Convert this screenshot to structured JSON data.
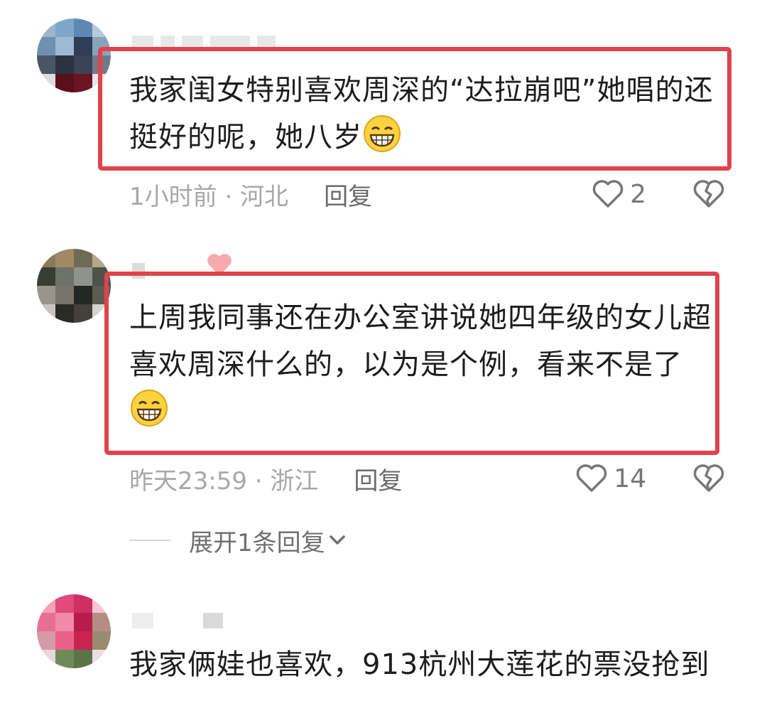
{
  "comments": [
    {
      "text": "我家闺女特别喜欢周深的“达拉崩吧”她唱的还挺好的呢，她八岁",
      "emoji": "grinning-face-icon",
      "time_location": "1小时前 · 河北",
      "reply_label": "回复",
      "likes": "2"
    },
    {
      "text": "上周我同事还在办公室讲说她四年级的女儿超喜欢周深什么的，以为是个例，看来不是了",
      "emoji": "grinning-face-icon",
      "time_location": "昨天23:59 · 浙江",
      "reply_label": "回复",
      "likes": "14",
      "expand_label": "展开1条回复"
    },
    {
      "text": "我家俩娃也喜欢，913杭州大莲花的票没抢到"
    }
  ],
  "colors": {
    "highlight_border": "#e0434b",
    "meta_text": "#a8a8a8",
    "body_text": "#1d1d1d"
  }
}
